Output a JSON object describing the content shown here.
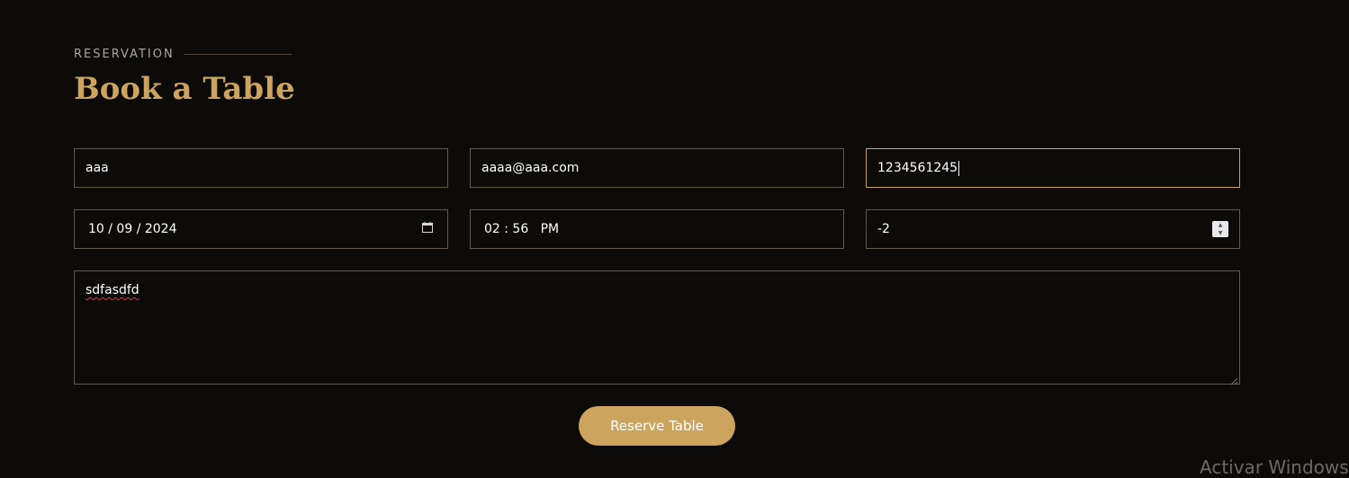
{
  "header": {
    "section_tag": "RESERVATION",
    "title": "Book a Table"
  },
  "form": {
    "name": {
      "value": "aaa"
    },
    "email": {
      "value": "aaaa@aaa.com"
    },
    "phone": {
      "value": "1234561245"
    },
    "date": {
      "value": "10 / 09 / 2024",
      "icon": "calendar-icon"
    },
    "time": {
      "value": "02 : 56   PM"
    },
    "people": {
      "value": "-2",
      "icon": "number-spinner"
    },
    "message": {
      "value": "sdfasdfd"
    },
    "submit_label": "Reserve Table"
  },
  "watermark": {
    "text": "Activar Windows"
  },
  "colors": {
    "background": "#0c0b09",
    "accent": "#cda45e",
    "field_border": "#625b4b",
    "text": "#ffffff"
  }
}
